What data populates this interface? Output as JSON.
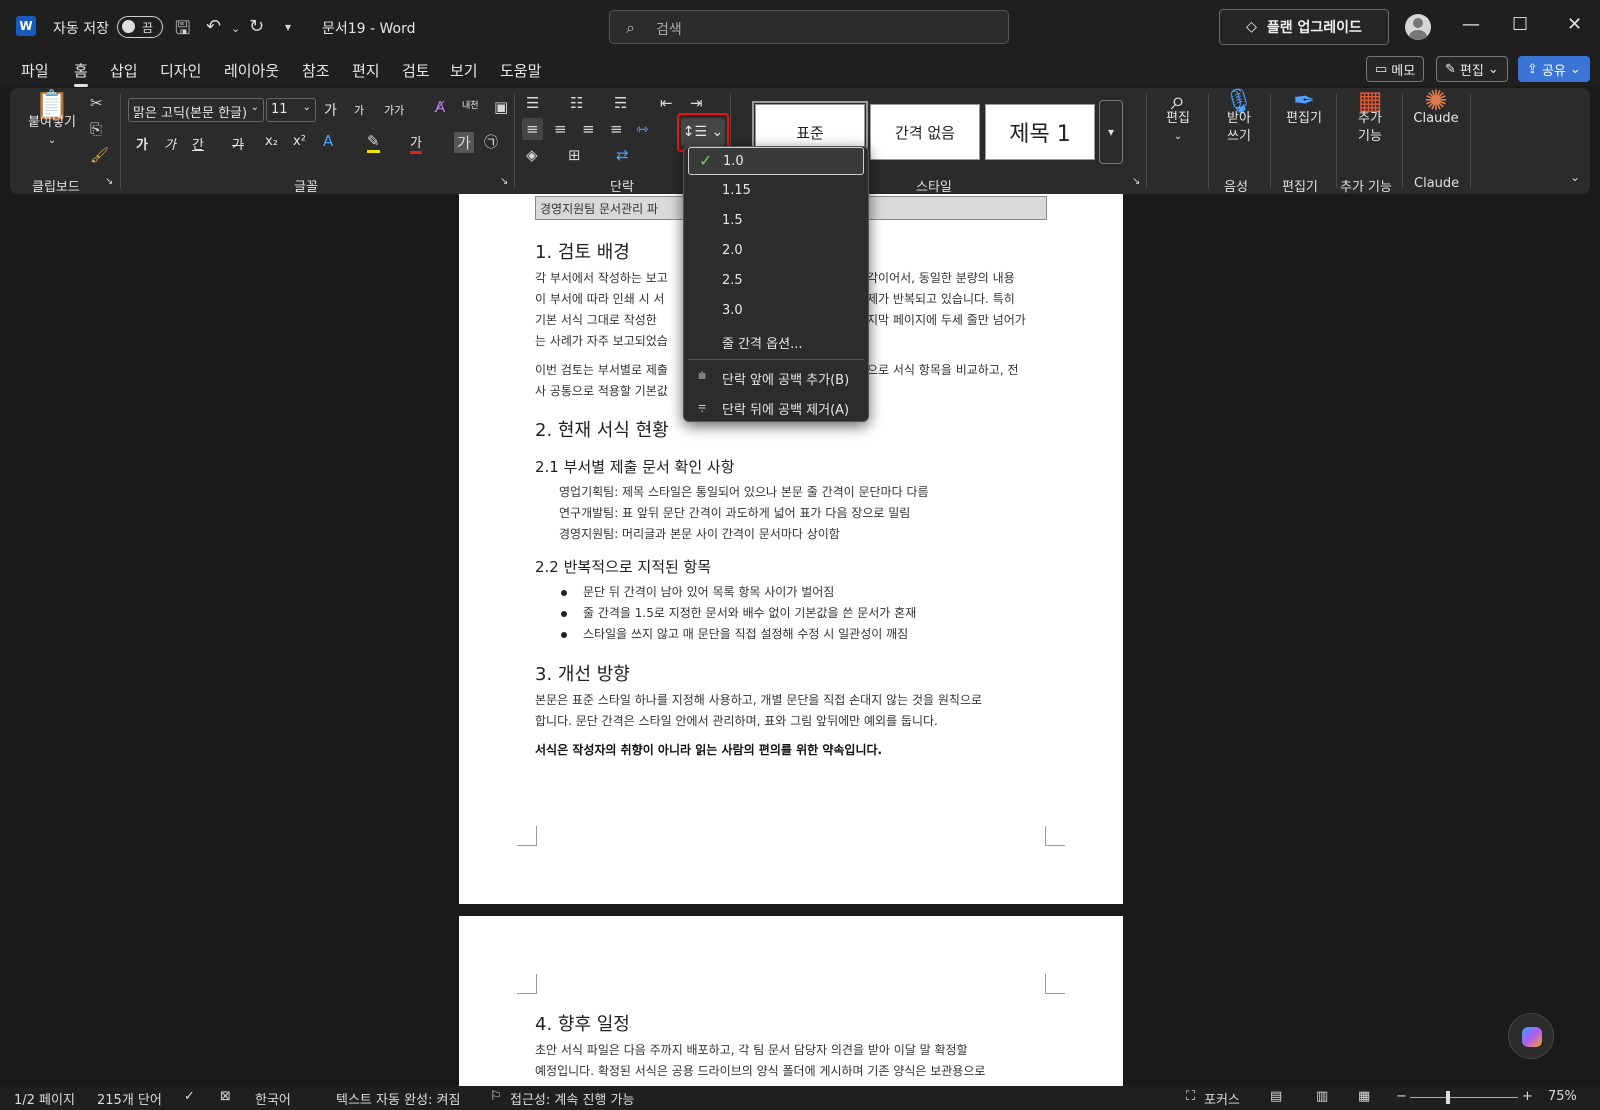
{
  "titlebar": {
    "app_icon": "W",
    "autosave_label": "자동 저장",
    "autosave_state": "끔",
    "doc_title": "문서19  -  Word",
    "search_placeholder": "검색",
    "upgrade_label": "플랜 업그레이드",
    "minimize": "—",
    "maximize": "☐",
    "close": "✕"
  },
  "menu": {
    "tabs": [
      "파일",
      "홈",
      "삽입",
      "디자인",
      "레이아웃",
      "참조",
      "편지",
      "검토",
      "보기",
      "도움말"
    ],
    "active": "홈",
    "memo_label": "메모",
    "edit_label": "편집",
    "share_label": "공유"
  },
  "ribbon": {
    "clipboard": {
      "paste_label": "붙여넣기",
      "group_label": "클립보드"
    },
    "font": {
      "font_name": "맑은 고딕(본문 한글)",
      "font_size": "11",
      "grow": "가",
      "shrink": "가",
      "case": "가가",
      "ruby": "내천",
      "bold": "가",
      "italic": "가",
      "underline": "간",
      "strike": "가",
      "sub": "x₂",
      "sup": "x²",
      "color_a": "가",
      "circle": "㉠",
      "group_label": "글꼴"
    },
    "paragraph": {
      "group_label": "단락"
    },
    "styles": {
      "items": [
        "표준",
        "간격 없음",
        "제목 1"
      ],
      "group_label": "스타일"
    },
    "editing": {
      "label": "편집"
    },
    "voice": {
      "label": "받아\n쓰기",
      "line1": "받아",
      "line2": "쓰기",
      "group_label": "음성"
    },
    "editor": {
      "label": "편집기",
      "group_label": "편집기"
    },
    "addins": {
      "line1": "추가",
      "line2": "기능",
      "group_label": "추가 기능"
    },
    "claude": {
      "label": "Claude",
      "group_label": "Claude"
    }
  },
  "line_spacing_menu": {
    "options": [
      "1.0",
      "1.15",
      "1.5",
      "2.0",
      "2.5",
      "3.0"
    ],
    "selected": "1.0",
    "more_options": "줄 간격 옵션...",
    "add_space_before": "단락 앞에 공백 추가(B)",
    "remove_space_after": "단락 뒤에 공백 제거(A)"
  },
  "document": {
    "header_box": "경영지원팀 문서관리 파",
    "sec1_title": "1. 검토 배경",
    "sec1_p1_lines": [
      "각 부서에서 작성하는 보고",
      "이 부서에 따라 인쇄 시 서",
      "기본 서식 그대로 작성한",
      "는 사례가 자주 보고되었습"
    ],
    "sec1_p1_right": [
      "각이어서, 동일한 분량의 내용",
      "제가 반복되고 있습니다. 특히",
      "지막 페이지에 두세 줄만 넘어가",
      ""
    ],
    "sec1_p2_lines": [
      "이번 검토는 부서별로 제출",
      "사 공통으로 적용할 기본값"
    ],
    "sec1_p2_right": "으로 서식 항목을 비교하고, 전",
    "sec2_title": "2. 현재 서식 현황",
    "sec21_title": "2.1 부서별 제출 문서 확인 사항",
    "sec21_items": [
      "영업기획팀: 제목 스타일은 통일되어 있으나 본문 줄 간격이 문단마다 다름",
      "연구개발팀: 표 앞뒤 문단 간격이 과도하게 넓어 표가 다음 장으로 밀림",
      "경영지원팀: 머리글과 본문 사이 간격이 문서마다 상이함"
    ],
    "sec22_title": "2.2 반복적으로 지적된 항목",
    "sec22_items": [
      "문단 뒤 간격이 남아 있어 목록 항목 사이가 벌어짐",
      "줄 간격을 1.5로 지정한 문서와 배수 없이 기본값을 쓴 문서가 혼재",
      "스타일을 쓰지 않고 매 문단을 직접 설정해 수정 시 일관성이 깨짐"
    ],
    "sec3_title": "3. 개선 방향",
    "sec3_lines": [
      "본문은 표준 스타일 하나를 지정해 사용하고, 개별 문단을 직접 손대지 않는 것을 원칙으로",
      "합니다. 문단 간격은 스타일 안에서 관리하며, 표와 그림 앞뒤에만 예외를 둡니다."
    ],
    "sec3_bold": "서식은 작성자의 취향이 아니라 읽는 사람의 편의를 위한 약속입니다.",
    "sec4_title": "4. 향후 일정",
    "sec4_lines": [
      "초안 서식 파일은 다음 주까지 배포하고, 각 팀 문서 담당자 의견을 받아 이달 말 확정할",
      "예정입니다. 확정된 서식은 공용 드라이브의 양식 폴더에 게시하며 기존 양식은 보관용으로"
    ]
  },
  "status": {
    "page": "1/2 페이지",
    "words": "215개 단어",
    "language": "한국어",
    "autocomplete": "텍스트 자동 완성: 켜짐",
    "accessibility": "접근성: 계속 진행 가능",
    "focus": "포커스",
    "zoom": "75%",
    "minus": "−",
    "plus": "+"
  },
  "colors": {
    "accent": "#3b74d4",
    "highlight_red": "#e11111",
    "bg": "#1a1a1a"
  }
}
